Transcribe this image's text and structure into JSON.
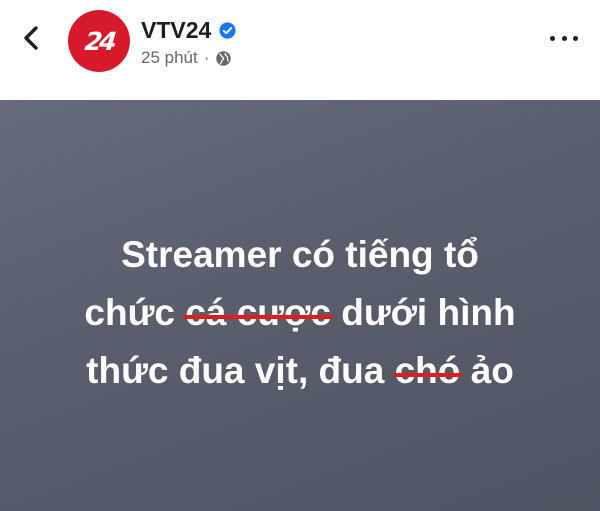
{
  "header": {
    "page_name": "VTV24",
    "avatar_text": "24",
    "timestamp": "25 phút",
    "separator": "·",
    "icons": {
      "back": "chevron-left-icon",
      "verified": "verified-badge-icon",
      "privacy": "globe-icon",
      "more": "more-horizontal-icon"
    }
  },
  "post": {
    "line1": "Streamer có tiếng tổ",
    "line2_start": "chức",
    "line2_struck": "cá cược",
    "line2_end": "dưới hình",
    "line3_start": "thức đua vịt, đua",
    "line3_struck": "chó",
    "line3_end": "ảo"
  },
  "colors": {
    "brand_red": "#d71a2b",
    "verified_blue": "#1877f2",
    "strike_red": "#e51a1a",
    "card_background": "#5d6371"
  }
}
